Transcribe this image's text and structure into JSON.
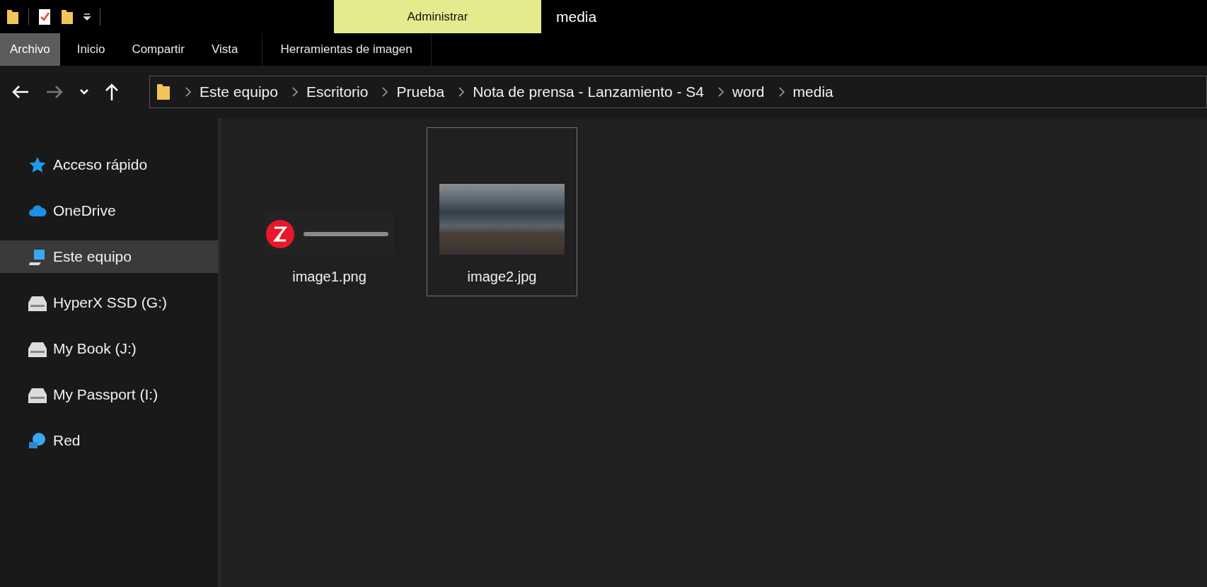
{
  "quick_access_toolbar": {
    "context_tab": "Administrar"
  },
  "window": {
    "title": "media"
  },
  "ribbon_tabs": [
    {
      "label": "Archivo",
      "selected": true
    },
    {
      "label": "Inicio",
      "selected": false
    },
    {
      "label": "Compartir",
      "selected": false
    },
    {
      "label": "Vista",
      "selected": false
    },
    {
      "label": "Herramientas de imagen",
      "selected": false,
      "kind": "contextual"
    }
  ],
  "navigation": {
    "back_disabled": false,
    "forward_disabled": true
  },
  "address_bar": {
    "breadcrumbs": [
      "Este equipo",
      "Escritorio",
      "Prueba",
      "Nota de prensa - Lanzamiento - S4",
      "word",
      "media"
    ]
  },
  "sidebar": {
    "items": [
      {
        "label": "Acceso rápido",
        "kind": "star",
        "selected": false
      },
      {
        "label": "OneDrive",
        "kind": "cloud",
        "selected": false
      },
      {
        "label": "Este equipo",
        "kind": "computer",
        "selected": true
      },
      {
        "label": "HyperX SSD (G:)",
        "kind": "drive",
        "selected": false
      },
      {
        "label": "My Book (J:)",
        "kind": "drive",
        "selected": false
      },
      {
        "label": "My Passport (I:)",
        "kind": "drive",
        "selected": false
      },
      {
        "label": "Red",
        "kind": "network",
        "selected": false
      }
    ]
  },
  "files": [
    {
      "name": "image1.png",
      "kind": "logo",
      "selected": false
    },
    {
      "name": "image2.jpg",
      "kind": "photo",
      "selected": true
    }
  ]
}
